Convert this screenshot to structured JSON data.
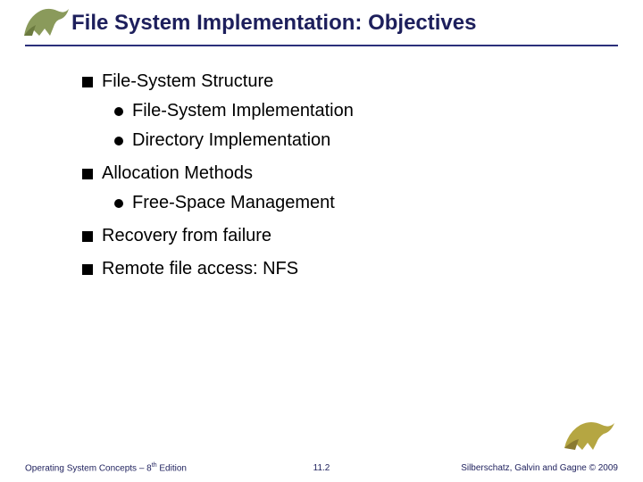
{
  "slide": {
    "title": "File System Implementation: Objectives",
    "bullets": {
      "b1": "File-System Structure",
      "b1a": "File-System Implementation",
      "b1b": "Directory Implementation",
      "b2": "Allocation Methods",
      "b2a": "Free-Space Management",
      "b3": "Recovery from failure",
      "b4": "Remote file access: NFS"
    },
    "footer": {
      "left_prefix": "Operating System Concepts – 8",
      "left_suffix": " Edition",
      "left_sup": "th",
      "center": "11.2",
      "right": "Silberschatz, Galvin and Gagne © 2009"
    }
  }
}
